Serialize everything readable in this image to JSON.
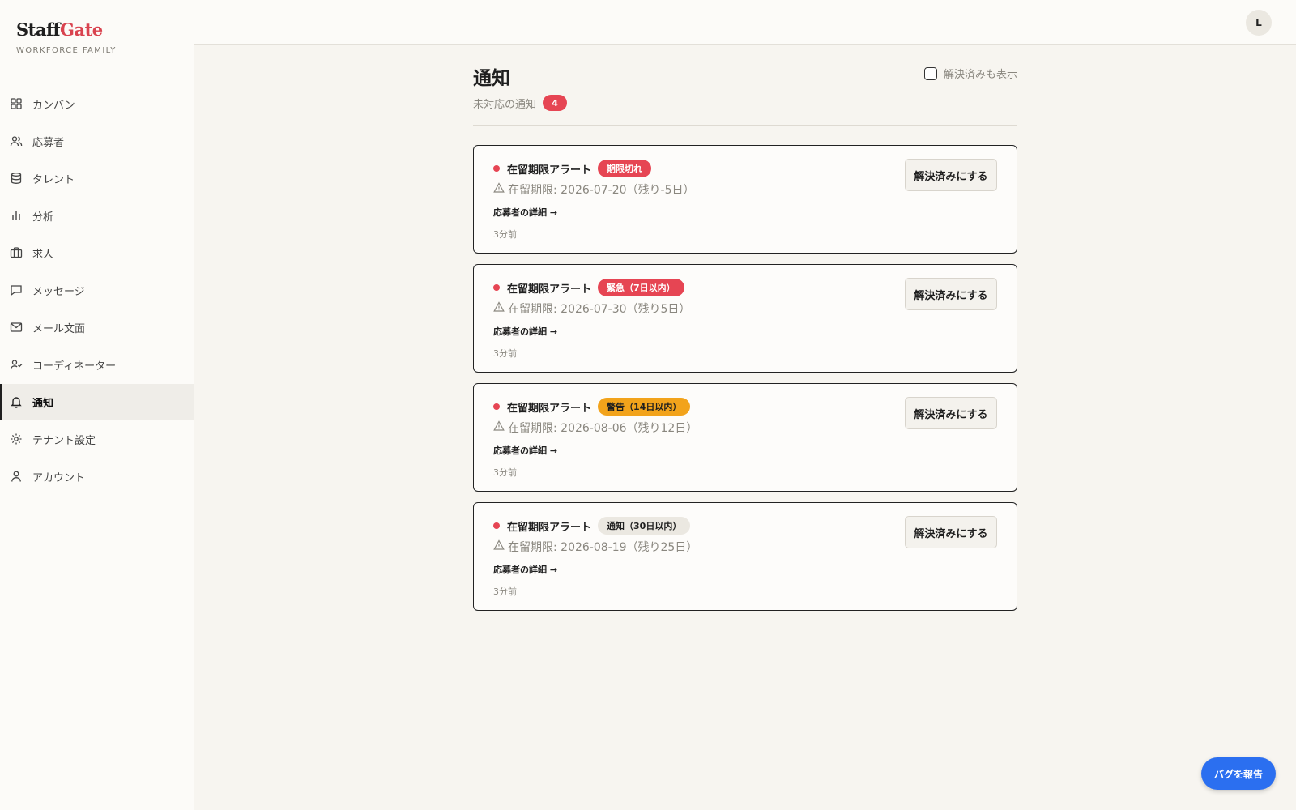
{
  "brand": {
    "name_part1": "Staff",
    "name_part2": "Gate",
    "subtitle": "WORKFORCE FAMILY",
    "accent": "#d9434f"
  },
  "sidebar": {
    "items": [
      {
        "key": "kanban",
        "label": "カンバン",
        "icon": "grid-icon"
      },
      {
        "key": "applicants",
        "label": "応募者",
        "icon": "users-icon"
      },
      {
        "key": "talent",
        "label": "タレント",
        "icon": "database-icon"
      },
      {
        "key": "analytics",
        "label": "分析",
        "icon": "bar-chart-icon"
      },
      {
        "key": "jobs",
        "label": "求人",
        "icon": "briefcase-icon"
      },
      {
        "key": "messages",
        "label": "メッセージ",
        "icon": "message-icon"
      },
      {
        "key": "mail",
        "label": "メール文面",
        "icon": "mail-icon"
      },
      {
        "key": "coordinators",
        "label": "コーディネーター",
        "icon": "user-check-icon"
      },
      {
        "key": "notifications",
        "label": "通知",
        "icon": "bell-icon",
        "active": true
      },
      {
        "key": "tenant",
        "label": "テナント設定",
        "icon": "gear-icon"
      },
      {
        "key": "account",
        "label": "アカウント",
        "icon": "user-icon"
      }
    ]
  },
  "header": {
    "avatar_initial": "L"
  },
  "page": {
    "title": "通知",
    "subtitle": "未対応の通知",
    "count": "4",
    "show_resolved_label": "解決済みも表示"
  },
  "notifications": [
    {
      "title": "在留期限アラート",
      "severity": "期限切れ",
      "severity_color": "#e64553",
      "expiry": "在留期限: 2026-07-20（残り-5日）",
      "link": "応募者の詳細 →",
      "time": "3分前",
      "action": "解決済みにする"
    },
    {
      "title": "在留期限アラート",
      "severity": "緊急（7日以内）",
      "severity_color": "#e64553",
      "expiry": "在留期限: 2026-07-30（残り5日）",
      "link": "応募者の詳細 →",
      "time": "3分前",
      "action": "解決済みにする"
    },
    {
      "title": "在留期限アラート",
      "severity": "警告（14日以内）",
      "severity_color": "#f2a31b",
      "expiry": "在留期限: 2026-08-06（残り12日）",
      "link": "応募者の詳細 →",
      "time": "3分前",
      "action": "解決済みにする"
    },
    {
      "title": "在留期限アラート",
      "severity": "通知（30日以内）",
      "severity_color": "#ebe8e1",
      "expiry": "在留期限: 2026-08-19（残り25日）",
      "link": "応募者の詳細 →",
      "time": "3分前",
      "action": "解決済みにする"
    }
  ],
  "bug_report_label": "バグを報告"
}
